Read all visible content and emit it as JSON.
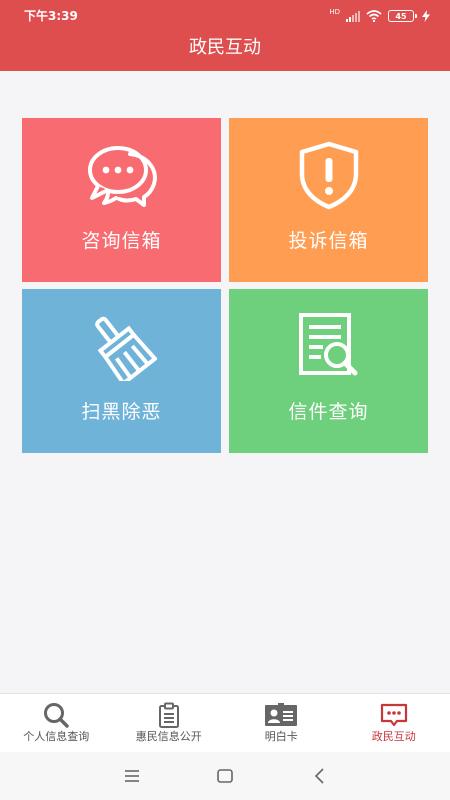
{
  "status_bar": {
    "time": "下午3:39",
    "network": "HD",
    "battery": "45"
  },
  "header": {
    "title": "政民互动"
  },
  "tiles": [
    {
      "label": "咨询信箱",
      "icon": "chat-bubbles-icon",
      "color": "#f86b70"
    },
    {
      "label": "投诉信箱",
      "icon": "shield-alert-icon",
      "color": "#ff9d53"
    },
    {
      "label": "扫黑除恶",
      "icon": "broom-icon",
      "color": "#6fb3d9"
    },
    {
      "label": "信件查询",
      "icon": "document-search-icon",
      "color": "#6ecf7c"
    }
  ],
  "bottom_nav": {
    "active_index": 3,
    "active_color": "#c9363a",
    "items": [
      {
        "label": "个人信息查询",
        "icon": "magnifier-icon"
      },
      {
        "label": "惠民信息公开",
        "icon": "clipboard-icon"
      },
      {
        "label": "明白卡",
        "icon": "id-card-icon"
      },
      {
        "label": "政民互动",
        "icon": "message-icon"
      }
    ]
  },
  "system_nav": {
    "buttons": [
      "menu-icon",
      "home-icon",
      "back-icon"
    ]
  },
  "colors": {
    "header_bg": "#de4e4f",
    "page_bg": "#f5f4f7"
  }
}
